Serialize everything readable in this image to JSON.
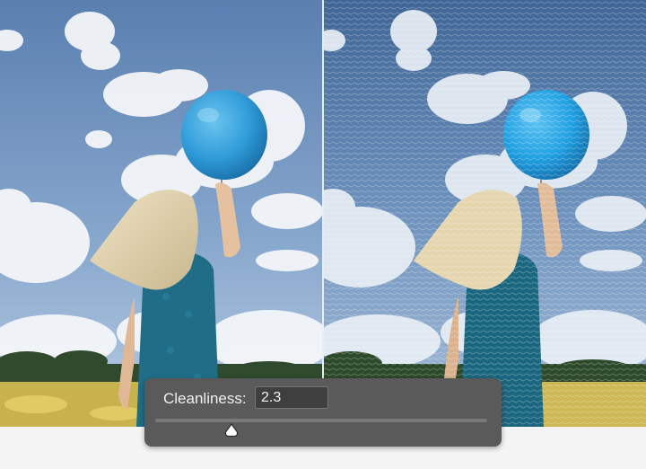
{
  "comparison": {
    "original_label": "",
    "effect_label": ""
  },
  "cleanliness_control": {
    "label": "Cleanliness:",
    "value": "2.3",
    "slider_fraction": 0.23
  },
  "colors": {
    "panel_bg": "#5a5a5a",
    "input_bg": "#3f3f3f",
    "sky_top": "#5e84b5",
    "balloon": "#3aa3dc",
    "dress": "#1f6d86"
  }
}
